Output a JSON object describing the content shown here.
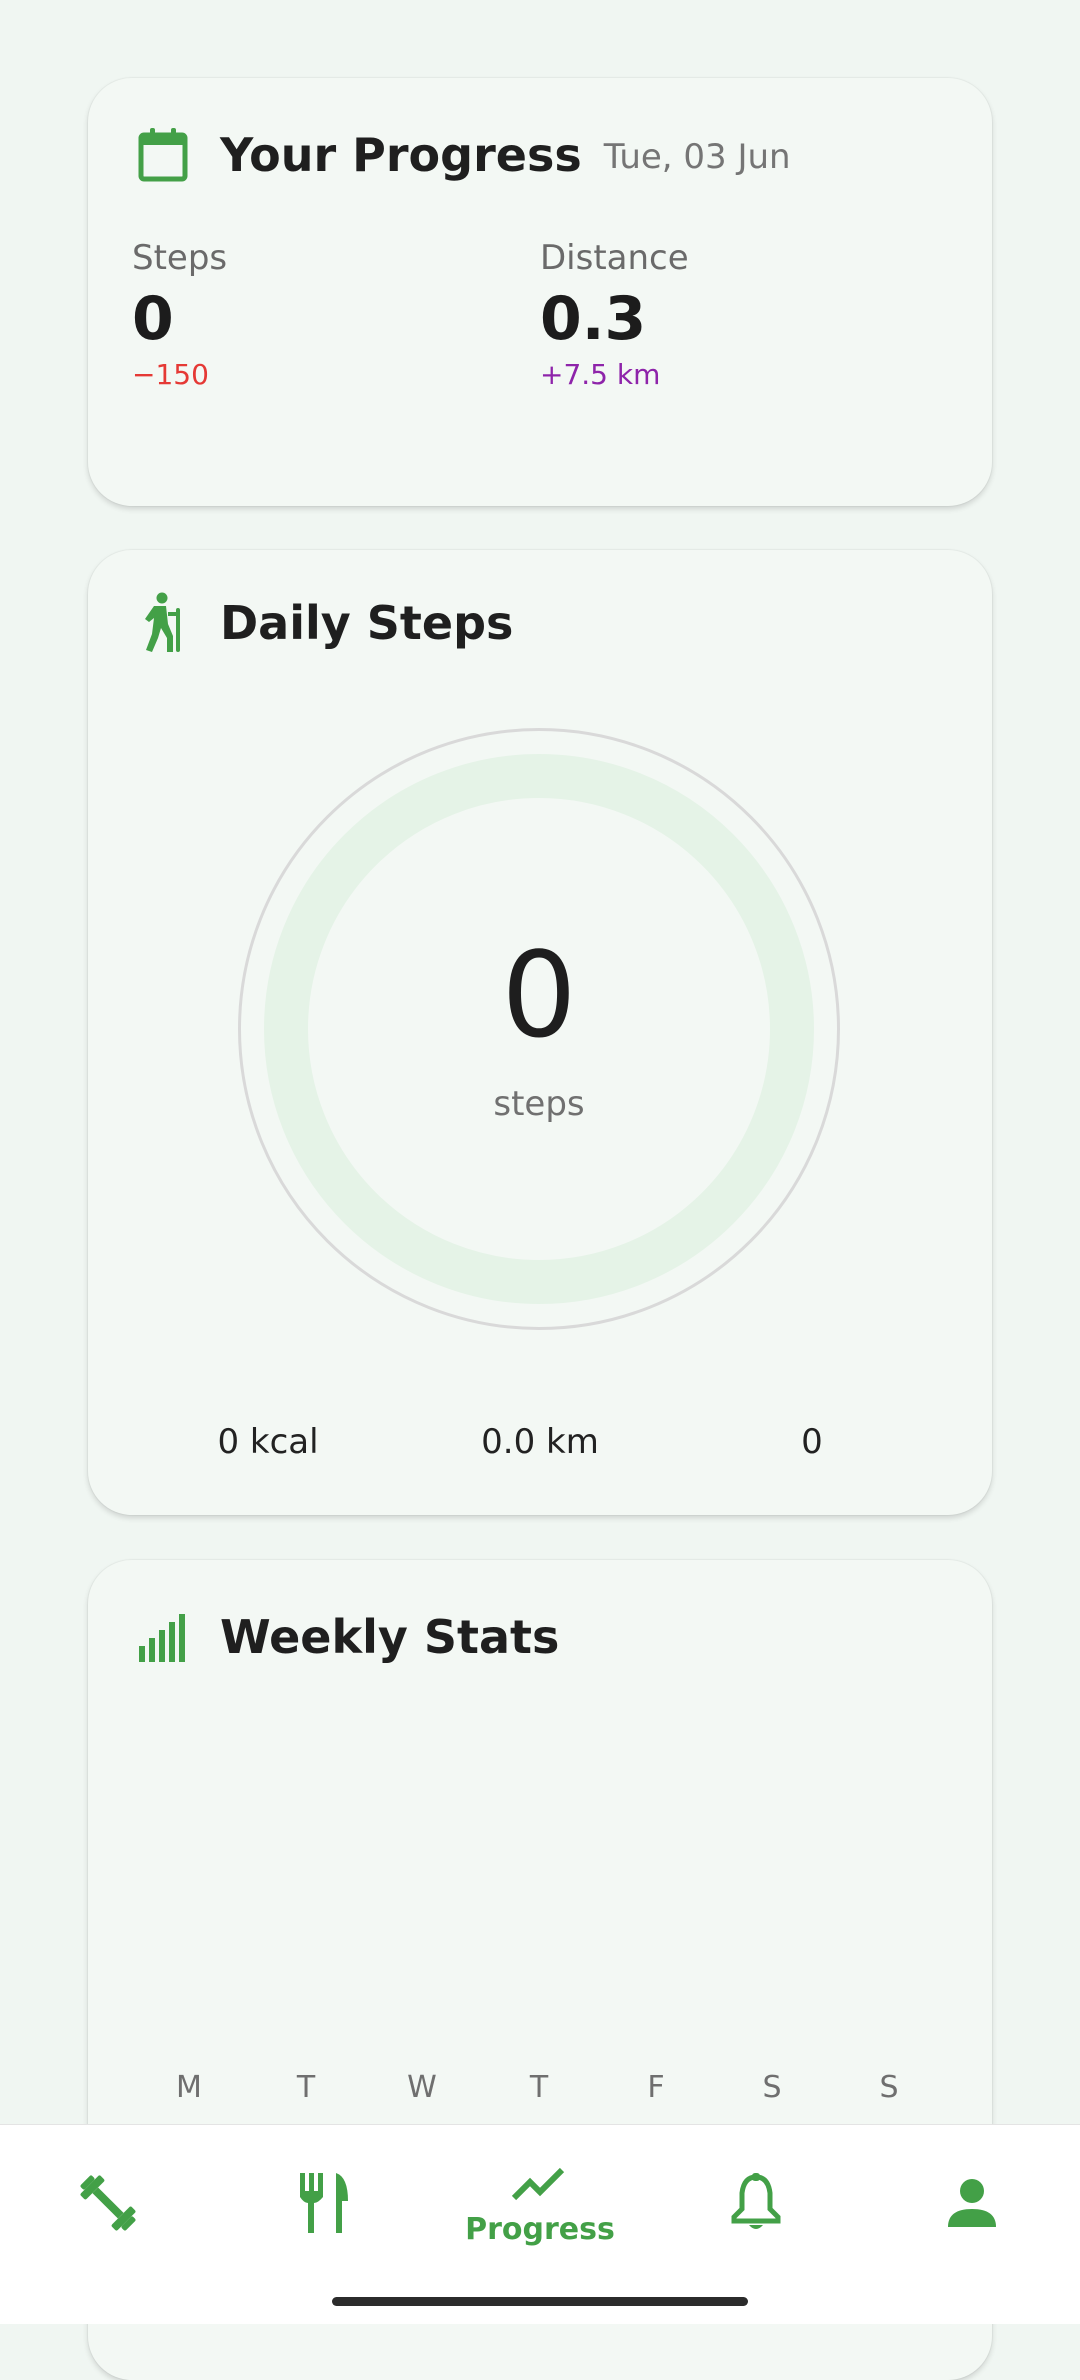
{
  "colors": {
    "accent": "#43a047",
    "negative": "#e53935",
    "positive": "#8e24aa"
  },
  "progress_card": {
    "icon": "calendar-icon",
    "title": "Your Progress",
    "date": "Tue, 03 Jun",
    "steps": {
      "label": "Steps",
      "value": "0",
      "delta": "−150"
    },
    "distance": {
      "label": "Distance",
      "value": "0.3",
      "delta": "+7.5 km"
    }
  },
  "steps_card": {
    "icon": "hiking-icon",
    "title": "Daily Steps",
    "ring_value": "0",
    "ring_unit": "steps",
    "ring_progress": 0,
    "calories": "0 kcal",
    "distance": "0.0 km",
    "extra": "0"
  },
  "weekly_card": {
    "icon": "bar-chart-icon",
    "title": "Weekly Stats",
    "days": [
      "M",
      "T",
      "W",
      "T",
      "F",
      "S",
      "S"
    ]
  },
  "bottom_nav": {
    "items": [
      {
        "icon": "dumbbell-icon",
        "label": ""
      },
      {
        "icon": "cutlery-icon",
        "label": ""
      },
      {
        "icon": "trending-up-icon",
        "label": "Progress",
        "active": true
      },
      {
        "icon": "bell-icon",
        "label": ""
      },
      {
        "icon": "person-icon",
        "label": ""
      }
    ]
  }
}
